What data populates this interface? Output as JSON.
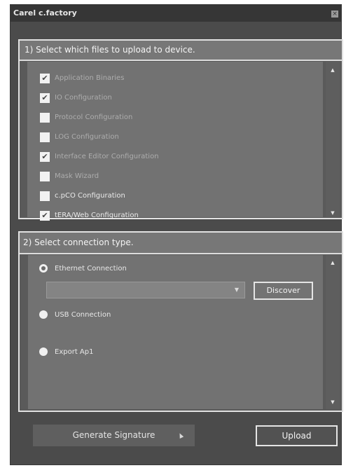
{
  "window": {
    "title": "Carel c.factory",
    "close_glyph": "×"
  },
  "files_section": {
    "header": "1) Select which files to upload to device.",
    "items": [
      {
        "label": "Application Binaries",
        "checked": true,
        "muted": true
      },
      {
        "label": "IO Configuration",
        "checked": true,
        "muted": true
      },
      {
        "label": "Protocol Configuration",
        "checked": false,
        "muted": true
      },
      {
        "label": "LOG Configuration",
        "checked": false,
        "muted": true
      },
      {
        "label": "Interface Editor Configuration",
        "checked": true,
        "muted": true
      },
      {
        "label": "Mask Wizard",
        "checked": false,
        "muted": true
      },
      {
        "label": "c.pCO Configuration",
        "checked": false,
        "muted": false
      },
      {
        "label": "tERA/Web Configuration",
        "checked": true,
        "muted": false
      }
    ],
    "scroll_up_glyph": "▲",
    "scroll_down_glyph": "▼"
  },
  "connection_section": {
    "header": "2) Select connection type.",
    "options": [
      {
        "label": "Ethernet Connection",
        "selected": true
      },
      {
        "label": "USB Connection",
        "selected": false
      },
      {
        "label": "Export Ap1",
        "selected": false
      }
    ],
    "dropdown_value": "",
    "dropdown_arrow_glyph": "▼",
    "discover_label": "Discover",
    "scroll_up_glyph": "▲",
    "scroll_down_glyph": "▼"
  },
  "footer": {
    "generate_label": "Generate Signature",
    "upload_label": "Upload"
  },
  "check_glyph": "✔"
}
